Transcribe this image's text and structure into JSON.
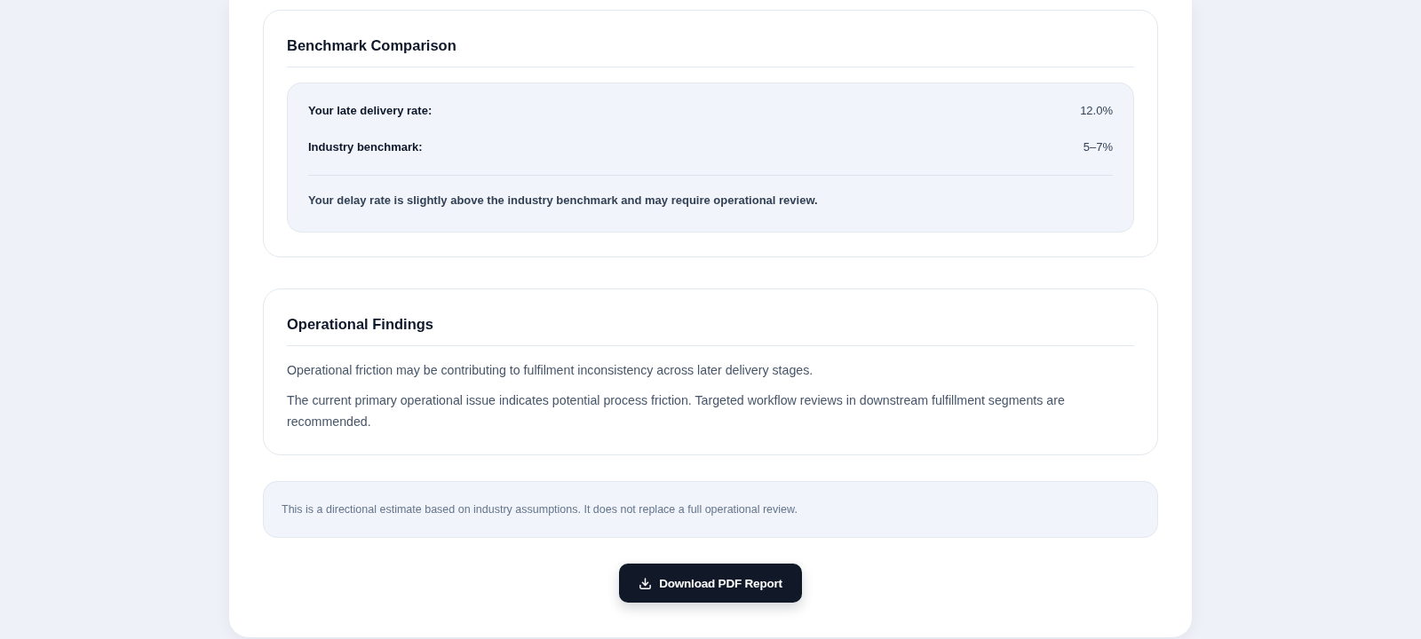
{
  "benchmark": {
    "title": "Benchmark Comparison",
    "rows": [
      {
        "label": "Your late delivery rate:",
        "value": "12.0%"
      },
      {
        "label": "Industry benchmark:",
        "value": "5–7%"
      }
    ],
    "note": "Your delay rate is slightly above the industry benchmark and may require operational review."
  },
  "findings": {
    "title": "Operational Findings",
    "paragraphs": [
      "Operational friction may be contributing to fulfilment inconsistency across later delivery stages.",
      "The current primary operational issue indicates potential process friction. Targeted workflow reviews in downstream fulfillment segments are recommended."
    ]
  },
  "disclaimer": "This is a directional estimate based on industry assumptions. It does not replace a full operational review.",
  "download_button": {
    "label": "Download PDF Report"
  }
}
